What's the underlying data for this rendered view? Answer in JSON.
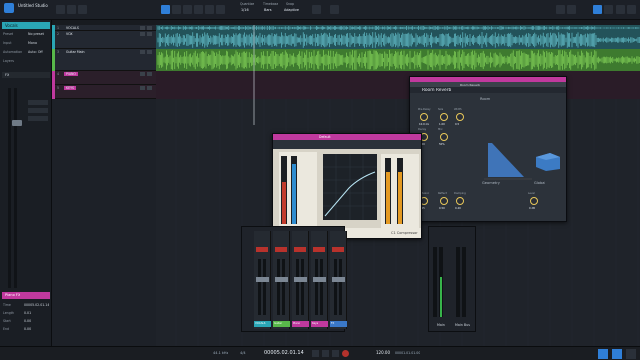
{
  "app": {
    "title": "Untitled Studio"
  },
  "topbar": {
    "quantize_label": "Quantize",
    "quantize_value": "1/16",
    "timebase_label": "Timebase",
    "timebase_value": "Bars",
    "snap_label": "Snap",
    "snap_value": "Adaptive"
  },
  "inspector": {
    "track_name": "Vocals",
    "rows": [
      {
        "label": "Preset",
        "value": "No preset"
      },
      {
        "label": "Input",
        "value": "Mono"
      },
      {
        "label": "Automation",
        "value": "Auto: Off"
      },
      {
        "label": "Layers",
        "value": ""
      }
    ],
    "fx_title": "FX",
    "bottom_track": "Piano FX",
    "bottom_rows": [
      {
        "label": "Time",
        "value": "00005.02.01.14"
      },
      {
        "label": "Length",
        "value": "0.01"
      },
      {
        "label": "Start",
        "value": "0.00"
      },
      {
        "label": "End",
        "value": "0.00"
      }
    ]
  },
  "tracks": [
    {
      "num": "1",
      "name": "VOCALS",
      "color": "#2aa6b5"
    },
    {
      "num": "2",
      "name": "VOX",
      "color": "#2aa6b5"
    },
    {
      "num": "3",
      "name": "Guitar Main",
      "color": "#58b84a"
    },
    {
      "num": "4",
      "name": "PIANO",
      "color": "#c0399e"
    },
    {
      "num": "5",
      "name": "KEYS",
      "color": "#c0399e"
    }
  ],
  "room_reverb": {
    "title": "Room Reverb",
    "preset": "Room Reverb",
    "sections": [
      "Room",
      "Geometry",
      "Global"
    ],
    "knobs": [
      "Pre-Delay",
      "Size",
      "Width",
      "Decay",
      "Mix",
      "Diffusion",
      "Reflect",
      "Damping",
      "Level"
    ],
    "values": [
      "10.0 ms",
      "1.00",
      "0.5",
      "1.20",
      "50%",
      "0.65",
      "0.50",
      "0.40",
      "0 dB"
    ]
  },
  "compressor": {
    "title": "Compressor",
    "preset": "Default",
    "footer": "C1 Compressor",
    "labels": [
      "Threshold",
      "Ratio",
      "Attack",
      "Release",
      "Makeup",
      "Gain"
    ]
  },
  "mixer": {
    "channels": [
      {
        "name": "VOCALS",
        "color": "#2aa6b5"
      },
      {
        "name": "Guitar",
        "color": "#58b84a"
      },
      {
        "name": "Piano",
        "color": "#c0399e"
      },
      {
        "name": "Keys",
        "color": "#c0399e"
      },
      {
        "name": "FX",
        "color": "#3a78c8"
      }
    ],
    "main_label": "Main",
    "out_label": "Main Bus"
  },
  "transport": {
    "tempo": "44.1 kHz",
    "time_sig": "4/4",
    "position": "00005.02.01.14",
    "bpm": "120.00",
    "loop_start": "00001.01.01.00"
  },
  "colors": {
    "accent": "#2f7fd8",
    "cyan": "#2aa6b5",
    "green": "#58b84a",
    "magenta": "#c0399e"
  }
}
